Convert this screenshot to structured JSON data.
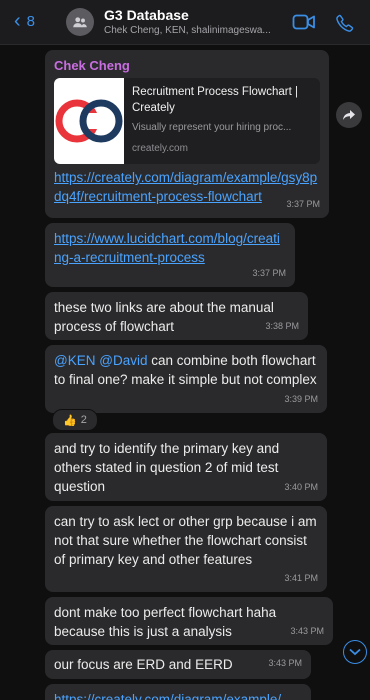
{
  "header": {
    "back_count": "8",
    "title": "G3 Database",
    "subtitle": "Chek Cheng, KEN, shalinimageswa..."
  },
  "messages": {
    "m1": {
      "sender": "Chek Cheng",
      "preview_title": "Recruitment Process Flowchart | Creately",
      "preview_desc": "Visually represent your hiring proc...",
      "preview_domain": "creately.com",
      "link": "https://creately.com/diagram/example/gsy8pdq4f/recruitment-process-flowchart",
      "time": "3:37 PM"
    },
    "m2": {
      "link": "https://www.lucidchart.com/blog/creating-a-recruitment-process",
      "time": "3:37 PM"
    },
    "m3": {
      "text": "these two links are about the manual process of flowchart",
      "time": "3:38 PM"
    },
    "m4": {
      "mention1": "@KEN",
      "mention2": "@David",
      "text": "can combine both flowchart to final one? make it simple but not complex",
      "time": "3:39 PM",
      "reaction_count": "2"
    },
    "m5": {
      "text": "and try to identify the primary key and others stated in question 2 of mid test question",
      "time": "3:40 PM"
    },
    "m6": {
      "text": "can try to ask lect or other grp because i am not that sure whether the flowchart consist of primary key and other features",
      "time": "3:41 PM"
    },
    "m7": {
      "text": "dont make too perfect flowchart haha because this is just a analysis",
      "time": "3:43 PM"
    },
    "m8": {
      "text": "our focus are ERD and EERD",
      "time": "3:43 PM"
    },
    "m9": {
      "link": "https://creately.com/diagram/example/"
    }
  },
  "colors": {
    "accent": "#3a8ee6",
    "link": "#4aa3ff",
    "sender": "#c86ee0",
    "bubble": "#2a2a2c"
  },
  "icons": [
    "chevron-left-icon",
    "group-avatar-icon",
    "video-call-icon",
    "phone-icon",
    "share-icon",
    "thumbs-up-icon",
    "scroll-down-icon",
    "creately-logo-icon"
  ]
}
